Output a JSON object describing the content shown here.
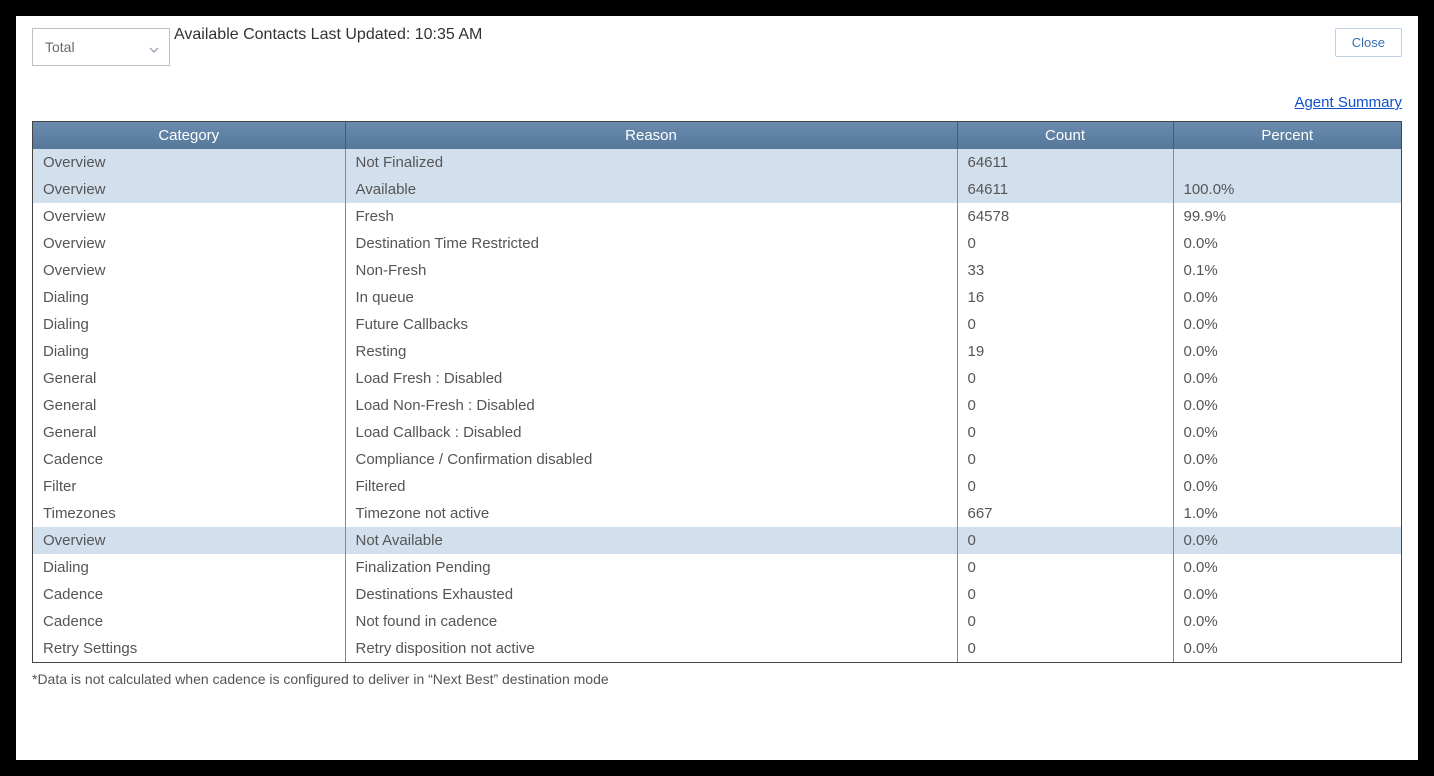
{
  "header": {
    "dropdown_value": "Total",
    "last_updated_label": "Available Contacts Last Updated: 10:35 AM",
    "close_label": "Close",
    "agent_summary_label": "Agent Summary"
  },
  "table": {
    "columns": {
      "category": "Category",
      "reason": "Reason",
      "count": "Count",
      "percent": "Percent"
    },
    "rows": [
      {
        "category": "Overview",
        "reason": "Not Finalized",
        "count": "64611",
        "percent": "",
        "highlight": true
      },
      {
        "category": "Overview",
        "reason": "Available",
        "count": "64611",
        "percent": "100.0%",
        "highlight": true
      },
      {
        "category": "Overview",
        "reason": "Fresh",
        "count": "64578",
        "percent": "99.9%",
        "highlight": false
      },
      {
        "category": "Overview",
        "reason": "Destination Time Restricted",
        "count": "0",
        "percent": "0.0%",
        "highlight": false
      },
      {
        "category": "Overview",
        "reason": "Non-Fresh",
        "count": "33",
        "percent": "0.1%",
        "highlight": false
      },
      {
        "category": "Dialing",
        "reason": "In queue",
        "count": "16",
        "percent": "0.0%",
        "highlight": false
      },
      {
        "category": "Dialing",
        "reason": "Future Callbacks",
        "count": "0",
        "percent": "0.0%",
        "highlight": false
      },
      {
        "category": "Dialing",
        "reason": "Resting",
        "count": "19",
        "percent": "0.0%",
        "highlight": false
      },
      {
        "category": "General",
        "reason": "Load Fresh : Disabled",
        "count": "0",
        "percent": "0.0%",
        "highlight": false
      },
      {
        "category": "General",
        "reason": "Load Non-Fresh : Disabled",
        "count": "0",
        "percent": "0.0%",
        "highlight": false
      },
      {
        "category": "General",
        "reason": "Load Callback : Disabled",
        "count": "0",
        "percent": "0.0%",
        "highlight": false
      },
      {
        "category": "Cadence",
        "reason": "Compliance / Confirmation disabled",
        "count": "0",
        "percent": "0.0%",
        "highlight": false
      },
      {
        "category": "Filter",
        "reason": "Filtered",
        "count": "0",
        "percent": "0.0%",
        "highlight": false
      },
      {
        "category": "Timezones",
        "reason": "Timezone not active",
        "count": "667",
        "percent": "1.0%",
        "highlight": false
      },
      {
        "category": "Overview",
        "reason": "Not Available",
        "count": "0",
        "percent": "0.0%",
        "highlight": true
      },
      {
        "category": "Dialing",
        "reason": "Finalization Pending",
        "count": "0",
        "percent": "0.0%",
        "highlight": false
      },
      {
        "category": "Cadence",
        "reason": "Destinations Exhausted",
        "count": "0",
        "percent": "0.0%",
        "highlight": false
      },
      {
        "category": "Cadence",
        "reason": "Not found in cadence",
        "count": "0",
        "percent": "0.0%",
        "highlight": false
      },
      {
        "category": "Retry Settings",
        "reason": "Retry disposition not active",
        "count": "0",
        "percent": "0.0%",
        "highlight": false
      }
    ]
  },
  "footnote": "*Data is not calculated when cadence is configured to deliver in “Next Best” destination mode"
}
